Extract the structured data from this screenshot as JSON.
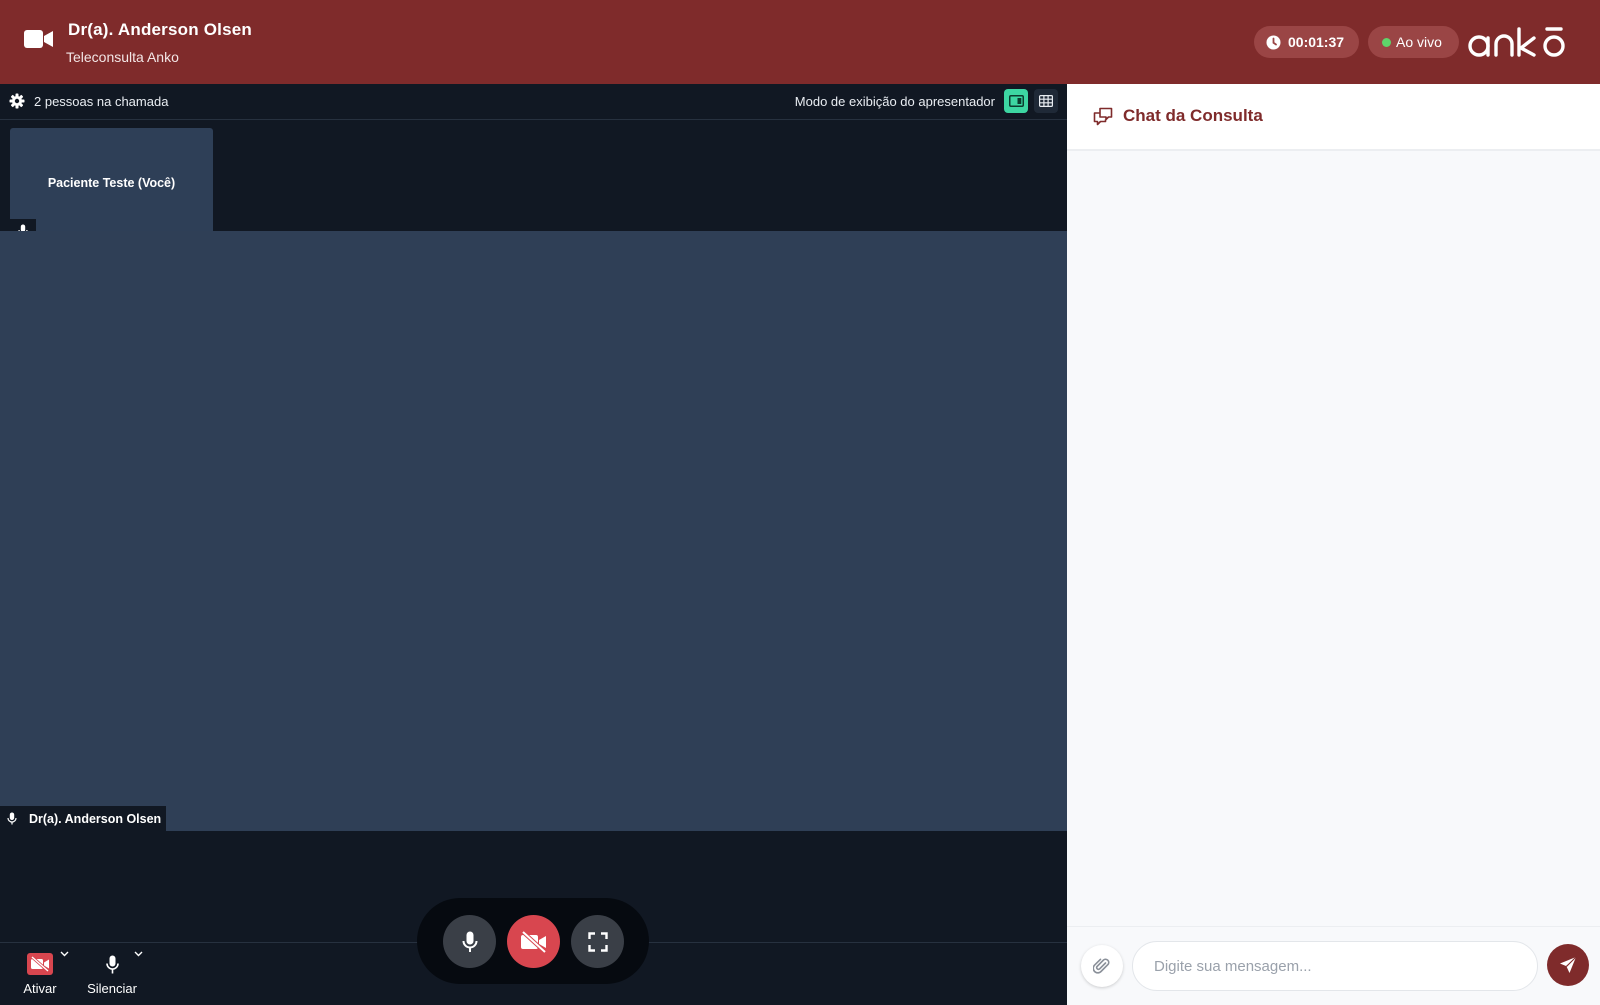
{
  "header": {
    "doctor_name": "Dr(a). Anderson Olsen",
    "subtitle": "Teleconsulta Anko",
    "timer": "00:01:37",
    "live_label": "Ao vivo",
    "logo_text": "anko",
    "brand_color": "#7f2b2b"
  },
  "toolbar": {
    "participants_label": "2 pessoas na chamada",
    "view_mode_label": "Modo de exibição do apresentador",
    "active_mode": "presenter",
    "active_mode_color": "#3dd6a2"
  },
  "video": {
    "self_tile_name": "Paciente Teste (Você)",
    "main_speaker_name": "Dr(a). Anderson Olsen"
  },
  "controls": {
    "camera_label": "Ativar",
    "mic_label": "Silenciar",
    "camera_off_color": "#d8464f",
    "icons": [
      "microphone-icon",
      "video-off-icon",
      "fullscreen-icon"
    ]
  },
  "chat": {
    "title": "Chat da Consulta",
    "input_placeholder": "Digite sua mensagem...",
    "messages": []
  }
}
